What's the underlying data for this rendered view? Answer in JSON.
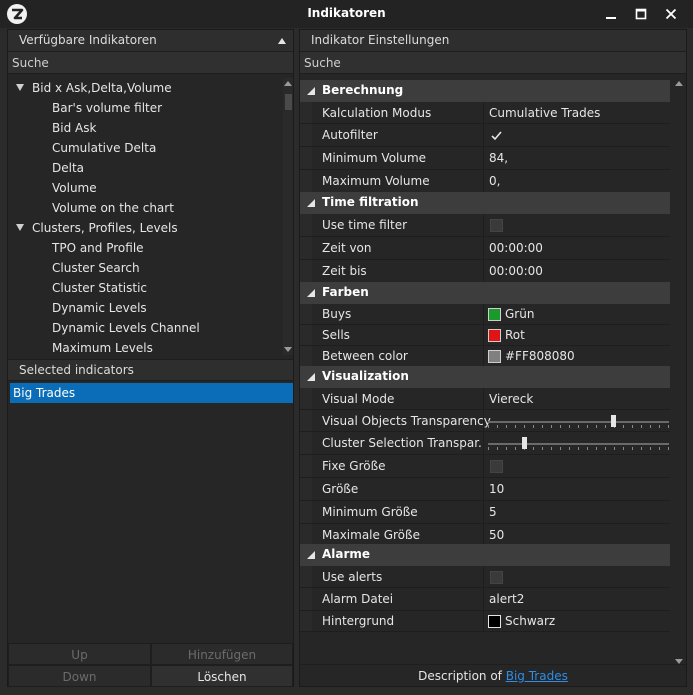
{
  "window": {
    "title": "Indikatoren"
  },
  "left_panel": {
    "header": "Verfügbare Indikatoren",
    "search_placeholder": "Suche",
    "tree": [
      {
        "label": "Bid x Ask,Delta,Volume",
        "group": true
      },
      {
        "label": "Bar's volume filter",
        "group": false
      },
      {
        "label": "Bid Ask",
        "group": false
      },
      {
        "label": "Cumulative Delta",
        "group": false
      },
      {
        "label": "Delta",
        "group": false
      },
      {
        "label": "Volume",
        "group": false
      },
      {
        "label": "Volume on the chart",
        "group": false
      },
      {
        "label": "Clusters, Profiles, Levels",
        "group": true
      },
      {
        "label": "TPO and Profile",
        "group": false
      },
      {
        "label": "Cluster Search",
        "group": false
      },
      {
        "label": "Cluster Statistic",
        "group": false
      },
      {
        "label": "Dynamic Levels",
        "group": false
      },
      {
        "label": "Dynamic Levels Channel",
        "group": false
      },
      {
        "label": "Maximum Levels",
        "group": false
      }
    ],
    "selected_header": "Selected indicators",
    "selected_items": [
      "Big Trades"
    ],
    "buttons": {
      "up": "Up",
      "add": "Hinzufügen",
      "down": "Down",
      "delete": "Löschen"
    }
  },
  "right_panel": {
    "header": "Indikator Einstellungen",
    "search_placeholder": "Suche",
    "categories": {
      "berechnung": "Berechnung",
      "time_filtration": "Time filtration",
      "farben": "Farben",
      "visualization": "Visualization",
      "alarme": "Alarme"
    },
    "props": {
      "kalkulation_modus": {
        "name": "Kalculation Modus",
        "value": "Cumulative Trades"
      },
      "autofilter": {
        "name": "Autofilter",
        "checked": true
      },
      "minimum_volume": {
        "name": "Minimum Volume",
        "value": "84,"
      },
      "maximum_volume": {
        "name": "Maximum Volume",
        "value": "0,"
      },
      "use_time_filter": {
        "name": "Use time filter",
        "checked": false
      },
      "zeit_von": {
        "name": "Zeit von",
        "value": "00:00:00"
      },
      "zeit_bis": {
        "name": "Zeit bis",
        "value": "00:00:00"
      },
      "buys": {
        "name": "Buys",
        "value": "Grün",
        "color": "#1a9a2a"
      },
      "sells": {
        "name": "Sells",
        "value": "Rot",
        "color": "#e01414"
      },
      "between_color": {
        "name": "Between color",
        "value": "#FF808080",
        "color": "#808080"
      },
      "visual_mode": {
        "name": "Visual Mode",
        "value": "Viereck"
      },
      "visual_objects_transparency": {
        "name": "Visual Objects Transparency",
        "level": 0.69
      },
      "cluster_selection_transparency": {
        "name": "Cluster Selection Transpar...",
        "level": 0.2
      },
      "fixe_groesse": {
        "name": "Fixe Größe",
        "checked": false
      },
      "groesse": {
        "name": "Größe",
        "value": "10"
      },
      "minimum_groesse": {
        "name": "Minimum Größe",
        "value": "5"
      },
      "maximale_groesse": {
        "name": "Maximale Größe",
        "value": "50"
      },
      "use_alerts": {
        "name": "Use alerts",
        "checked": false
      },
      "alarm_datei": {
        "name": "Alarm Datei",
        "value": "alert2"
      },
      "hintergrund": {
        "name": "Hintergrund",
        "value": "Schwarz",
        "color": "#000000"
      }
    },
    "footer": {
      "prefix": "Description of ",
      "link": "Big Trades"
    }
  }
}
